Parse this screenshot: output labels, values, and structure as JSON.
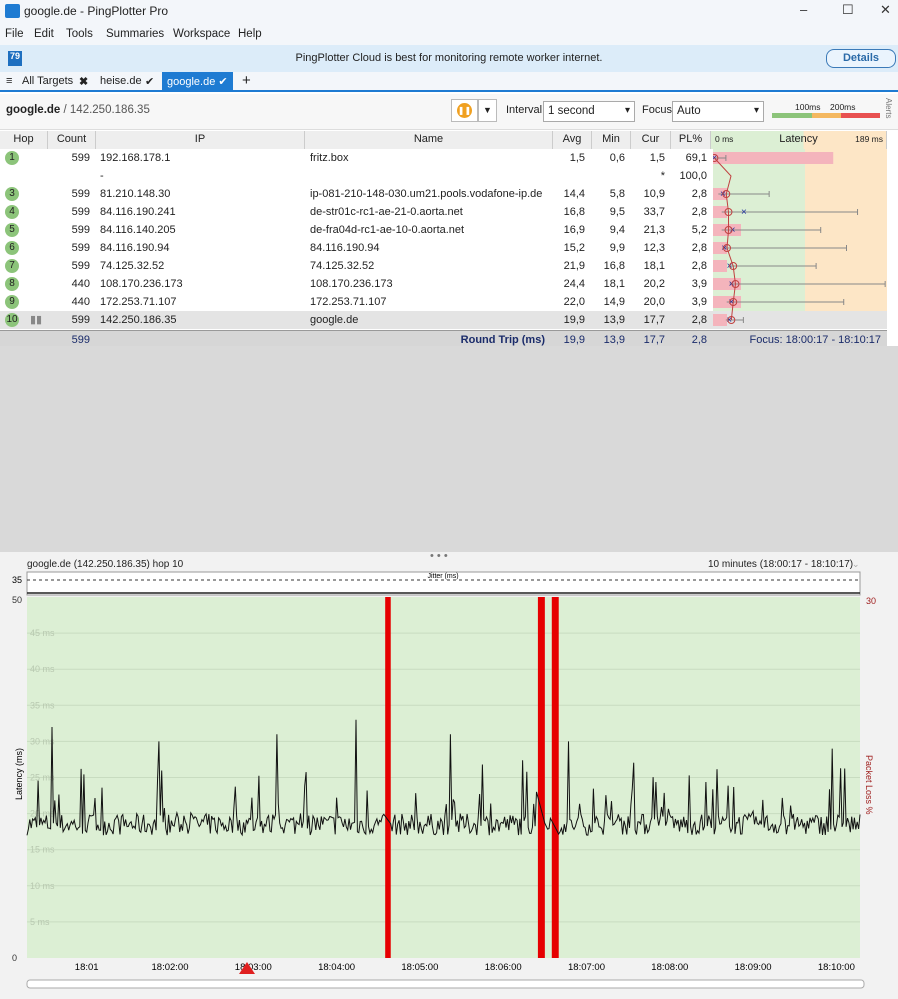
{
  "window": {
    "title": "google.de - PingPlotter Pro",
    "min": "–",
    "max": "☐",
    "close": "✕"
  },
  "menu": [
    "File",
    "Edit",
    "Tools",
    "Summaries",
    "Workspace",
    "Help"
  ],
  "banner": {
    "message": "PingPlotter Cloud is best for monitoring remote worker internet.",
    "button": "Details"
  },
  "tabs": {
    "all": "All Targets",
    "t1": "heise.de",
    "t2": "google.de",
    "add": "+"
  },
  "toolbar": {
    "target": "google.de",
    "ip": " / 142.250.186.35",
    "interval_label": "Interval",
    "interval": "1 second",
    "focus_label": "Focus",
    "focus": "Auto",
    "scale1": "100ms",
    "scale2": "200ms",
    "alerts": "Alerts"
  },
  "columns": {
    "hop": "Hop",
    "count": "Count",
    "ip": "IP",
    "name": "Name",
    "avg": "Avg",
    "min": "Min",
    "cur": "Cur",
    "pl": "PL%",
    "lat0": "0 ms",
    "latency": "Latency",
    "latmax": "189 ms"
  },
  "lat_max_ms": 189,
  "hops": [
    {
      "hop": "1",
      "count": "599",
      "ip": "192.168.178.1",
      "name": "fritz.box",
      "avg": "1,5",
      "min": "0,6",
      "cur": "1,5",
      "pl": "69,1",
      "max_ms": 14
    },
    {
      "hop": "",
      "count": "",
      "ip": "-",
      "name": "",
      "avg": "",
      "min": "",
      "cur": "*",
      "pl": "100,0"
    },
    {
      "hop": "3",
      "count": "599",
      "ip": "81.210.148.30",
      "name": "ip-081-210-148-030.um21.pools.vodafone-ip.de",
      "avg": "14,4",
      "min": "5,8",
      "cur": "10,9",
      "pl": "2,8",
      "max_ms": 61
    },
    {
      "hop": "4",
      "count": "599",
      "ip": "84.116.190.241",
      "name": "de-str01c-rc1-ae-21-0.aorta.net",
      "avg": "16,8",
      "min": "9,5",
      "cur": "33,7",
      "pl": "2,8",
      "max_ms": 157
    },
    {
      "hop": "5",
      "count": "599",
      "ip": "84.116.140.205",
      "name": "de-fra04d-rc1-ae-10-0.aorta.net",
      "avg": "16,9",
      "min": "9,4",
      "cur": "21,3",
      "pl": "5,2",
      "max_ms": 117
    },
    {
      "hop": "6",
      "count": "599",
      "ip": "84.116.190.94",
      "name": "84.116.190.94",
      "avg": "15,2",
      "min": "9,9",
      "cur": "12,3",
      "pl": "2,8",
      "max_ms": 145
    },
    {
      "hop": "7",
      "count": "599",
      "ip": "74.125.32.52",
      "name": "74.125.32.52",
      "avg": "21,9",
      "min": "16,8",
      "cur": "18,1",
      "pl": "2,8",
      "max_ms": 112
    },
    {
      "hop": "8",
      "count": "440",
      "ip": "108.170.236.173",
      "name": "108.170.236.173",
      "avg": "24,4",
      "min": "18,1",
      "cur": "20,2",
      "pl": "3,9",
      "max_ms": 187
    },
    {
      "hop": "9",
      "count": "440",
      "ip": "172.253.71.107",
      "name": "172.253.71.107",
      "avg": "22,0",
      "min": "14,9",
      "cur": "20,0",
      "pl": "3,9",
      "max_ms": 142
    },
    {
      "hop": "10",
      "count": "599",
      "ip": "142.250.186.35",
      "name": "google.de",
      "avg": "19,9",
      "min": "13,9",
      "cur": "17,7",
      "pl": "2,8",
      "max_ms": 33
    }
  ],
  "summary": {
    "count": "599",
    "label": "Round Trip (ms)",
    "avg": "19,9",
    "min": "13,9",
    "cur": "17,7",
    "pl": "2,8",
    "focus": "Focus: 18:00:17 - 18:10:17"
  },
  "chart_data": {
    "type": "line",
    "title": "google.de (142.250.186.35) hop 10",
    "range_label": "10 minutes (18:00:17 - 18:10:17)",
    "jitter_label": "Jitter (ms)",
    "jitter_max": "35",
    "ylabel": "Latency (ms)",
    "y2label": "Packet Loss %",
    "ylim": [
      0,
      50
    ],
    "y2max": "30",
    "yticks": [
      "50",
      "45 ms",
      "40 ms",
      "35 ms",
      "30 ms",
      "25 ms",
      "20 ms",
      "15 ms",
      "10 ms",
      "5 ms",
      "0"
    ],
    "xticks": [
      "18:01",
      "18:02:00",
      "18:03:00",
      "18:04:00",
      "18:05:00",
      "18:06:00",
      "18:07:00",
      "18:08:00",
      "18:09:00",
      "18:10:00"
    ],
    "x_range_sec": [
      0,
      600
    ],
    "xtick_sec": [
      43,
      103,
      163,
      223,
      283,
      343,
      403,
      463,
      523,
      583
    ],
    "loss_sec": [
      [
        258,
        262
      ],
      [
        368,
        373
      ],
      [
        378,
        383
      ]
    ],
    "baseline_ms": 18.5,
    "spikes": [
      [
        18,
        32
      ],
      [
        95,
        30
      ],
      [
        180,
        31
      ],
      [
        237,
        33
      ],
      [
        305,
        31
      ],
      [
        390,
        30
      ],
      [
        580,
        29
      ]
    ],
    "colors": {
      "bg": "#dcefd4",
      "line": "#111111",
      "loss": "#e60000"
    }
  }
}
